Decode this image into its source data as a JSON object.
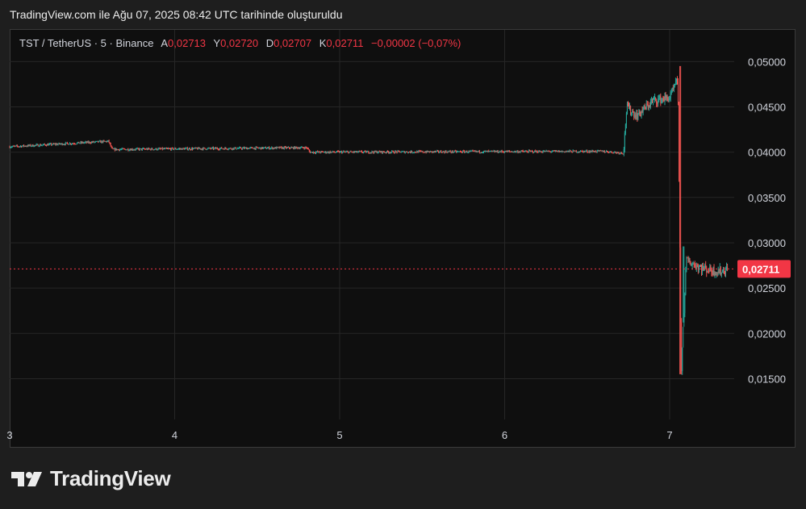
{
  "caption": "TradingView.com ile Ağu 07, 2025 08:42 UTC tarihinde oluşturuldu",
  "legend": {
    "symbol": "TST / TetherUS · 5 · Binance",
    "open_label": "A",
    "open": "0,02713",
    "high_label": "Y",
    "high": "0,02720",
    "low_label": "D",
    "low": "0,02707",
    "close_label": "K",
    "close": "0,02711",
    "change": "−0,00002 (−0,07%)"
  },
  "brand": {
    "name": "TradingView",
    "logo_icon": "tradingview-logo-icon"
  },
  "colors": {
    "up": "#26a69a",
    "down": "#ef5350",
    "price_tag": "#f23645",
    "grid": "#262626",
    "axis_text": "#d1d4dc"
  },
  "chart_data": {
    "type": "candlestick",
    "title": "TST / TetherUS · 5 · Binance",
    "xlabel": "",
    "ylabel": "",
    "x_ticks": [
      "3",
      "4",
      "5",
      "6",
      "7"
    ],
    "y_ticks": [
      "0,05000",
      "0,04500",
      "0,04000",
      "0,03500",
      "0,03000",
      "0,02500",
      "0,02000",
      "0,01500"
    ],
    "ylim": [
      0.0105,
      0.0535
    ],
    "grid": true,
    "last_price": 0.02711,
    "last_price_label": "0,02711",
    "approx_path": [
      {
        "day": 3.0,
        "price": 0.0406
      },
      {
        "day": 3.6,
        "price": 0.0412
      },
      {
        "day": 3.62,
        "price": 0.0403
      },
      {
        "day": 4.8,
        "price": 0.0405
      },
      {
        "day": 4.82,
        "price": 0.04
      },
      {
        "day": 6.6,
        "price": 0.0401
      },
      {
        "day": 6.72,
        "price": 0.0399
      },
      {
        "day": 6.74,
        "price": 0.045
      },
      {
        "day": 6.8,
        "price": 0.044
      },
      {
        "day": 6.9,
        "price": 0.0457
      },
      {
        "day": 7.0,
        "price": 0.046
      },
      {
        "day": 7.05,
        "price": 0.048
      },
      {
        "day": 7.07,
        "price": 0.0155
      },
      {
        "day": 7.1,
        "price": 0.028
      },
      {
        "day": 7.2,
        "price": 0.0272
      },
      {
        "day": 7.3,
        "price": 0.0268
      },
      {
        "day": 7.35,
        "price": 0.0271
      }
    ]
  }
}
